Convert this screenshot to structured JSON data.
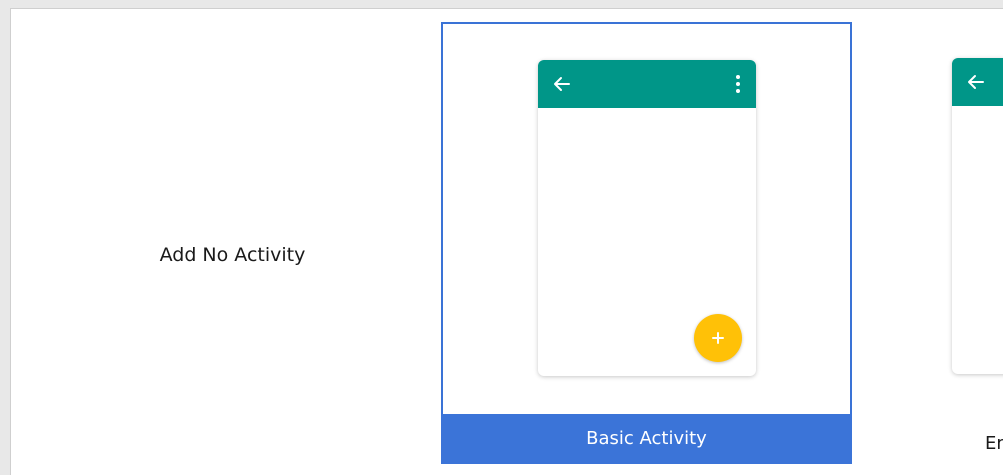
{
  "templates": [
    {
      "label": "Add No Activity",
      "selected": false
    },
    {
      "label": "Basic Activity",
      "selected": true
    },
    {
      "label": "Empty Activity",
      "selected": false
    }
  ],
  "colors": {
    "selection_blue": "#3b74d8",
    "appbar_teal": "#009688",
    "fab_amber": "#ffc107"
  },
  "icons": {
    "back": "arrow-left-icon",
    "overflow": "more-vert-icon",
    "fab": "plus-icon"
  }
}
